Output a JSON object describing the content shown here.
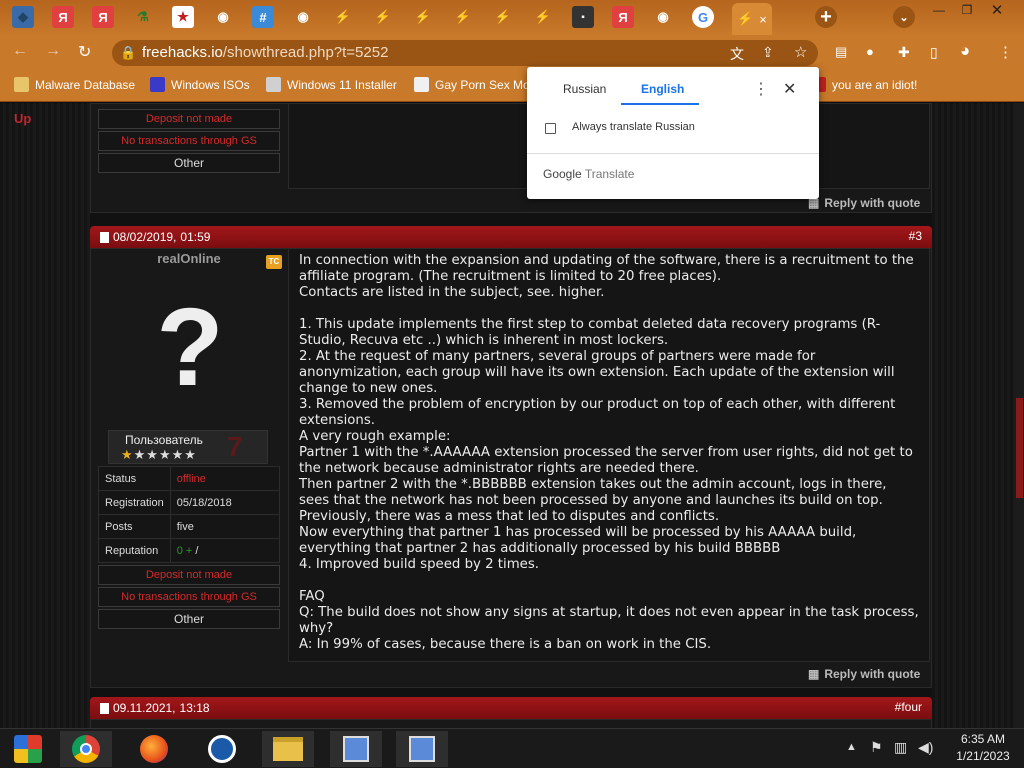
{
  "browser": {
    "url_host": "freehacks.io",
    "url_path": "/showthread.php?t=5252",
    "tab_close": "×",
    "new_tab": "+"
  },
  "bookmarks": [
    {
      "label": "Malware Database",
      "icon_color": "#e8c46a"
    },
    {
      "label": "Windows ISOs",
      "icon_color": "#3a3ac8"
    },
    {
      "label": "Windows 11 Installer",
      "icon_color": "#d0d0d0"
    },
    {
      "label": "Gay Porn Sex Mo",
      "icon_color": "#f0f0f0"
    },
    {
      "label": "you are an idiot!",
      "icon_color": "#c02020"
    }
  ],
  "translate": {
    "tab_source": "Russian",
    "tab_target": "English",
    "checkbox_label": "Always translate Russian",
    "brand_google": "Google",
    "brand_translate": "Translate"
  },
  "page": {
    "up_link": "Up"
  },
  "post_prev": {
    "badge_deposit": "Deposit not made",
    "badge_transactions": "No transactions through GS",
    "other": "Other",
    "reply_label": "Reply with quote"
  },
  "post3": {
    "date": "08/02/2019,",
    "time": "01:59",
    "number": "#3",
    "username": "realOnline",
    "badge": "TC",
    "role": "Пользователь",
    "status_label": "Status",
    "status_value": "offline",
    "registration_label": "Registration",
    "registration_value": "05/18/2018",
    "posts_label": "Posts",
    "posts_value": "five",
    "reputation_label": "Reputation",
    "reputation_value": "0 +",
    "reputation_suffix": "/",
    "badge_deposit": "Deposit not made",
    "badge_transactions": "No transactions through GS",
    "other": "Other",
    "reply_label": "Reply with quote",
    "lines": [
      "In connection with the expansion and updating of the software, there is a recruitment to the affiliate program. (The recruitment is limited to 20 free places).",
      "Contacts are listed in the subject, see. higher.",
      "",
      "1. This update implements the first step to combat deleted data recovery programs (R-Studio, Recuva etc ..) which is inherent in most lockers.",
      "2. At the request of many partners, several groups of partners were made for anonymization, each group will have its own extension. Each update of the extension will change to new ones.",
      "3. Removed the problem of encryption by our product on top of each other, with different extensions.",
      "A very rough example:",
      "Partner 1 with the *.AAAAAA extension processed the server from user rights, did not get to the network because administrator rights are needed there.",
      "Then partner 2 with the *.BBBBBB extension takes out the admin account, logs in there, sees that the network has not been processed by anyone and launches its build on top.",
      "Previously, there was a mess that led to disputes and conflicts.",
      "Now everything that partner 1 has processed will be processed by his AAAAA build, everything that partner 2 has additionally processed by his build BBBBB",
      "4. Improved build speed by 2 times.",
      "",
      "FAQ",
      "Q: The build does not show any signs at startup, it does not even appear in the task process, why?",
      "A: In 99% of cases, because there is a ban on work in the CIS."
    ]
  },
  "post4": {
    "date": "09.11.2021,",
    "time": "13:18",
    "number": "#four"
  },
  "clock": {
    "time": "6:35 AM",
    "date": "1/21/2023"
  },
  "colors": {
    "accent_orange": "#c8792a",
    "post_header_red": "#a3171a",
    "warning_red": "#d42a2a",
    "link_blue": "#1a73e8"
  }
}
